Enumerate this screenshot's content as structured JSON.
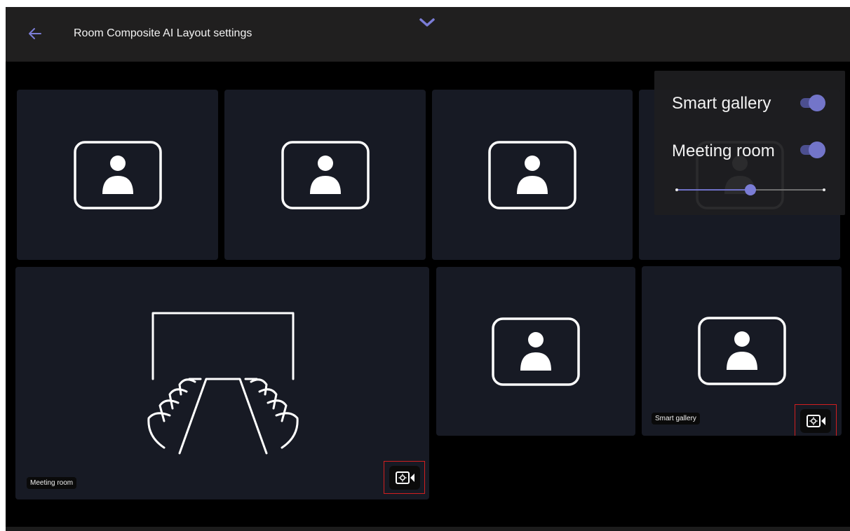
{
  "header": {
    "title": "Room Composite AI Layout settings",
    "back_icon": "arrow-left-icon",
    "collapse_icon": "chevron-down-icon"
  },
  "tiles": {
    "participant_icon": "person-frame-icon",
    "meeting_room": {
      "label": "Meeting room",
      "icon": "meeting-room-table-icon",
      "camera_icon": "camera-settings-icon"
    },
    "smart_gallery": {
      "label": "Smart gallery",
      "camera_icon": "camera-settings-icon"
    }
  },
  "settings_panel": {
    "smart_gallery": {
      "label": "Smart gallery",
      "enabled": true
    },
    "meeting_room": {
      "label": "Meeting room",
      "enabled": true
    },
    "slider": {
      "value": 0.5
    }
  },
  "colors": {
    "accent": "#7375c9",
    "toggle_track": "#4c4f8f",
    "tile_background": "#171a24",
    "header_background": "#201f1f",
    "highlight_border": "#d11f1f"
  }
}
